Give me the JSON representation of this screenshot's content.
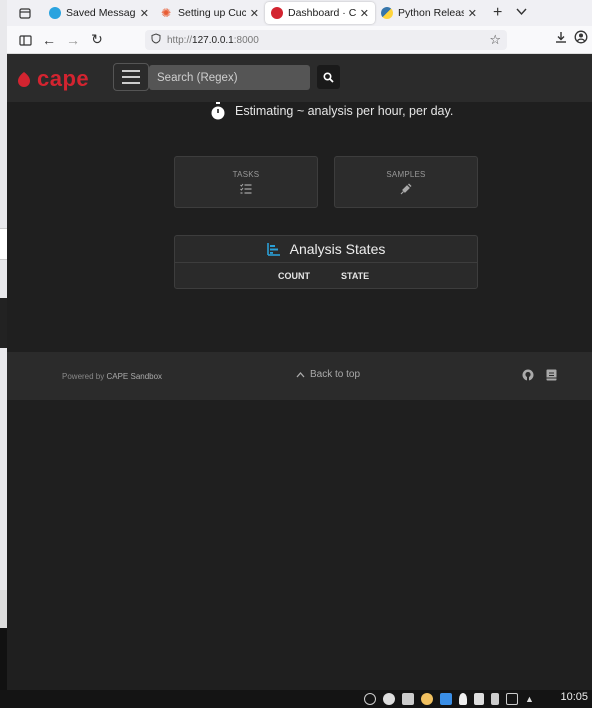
{
  "browser": {
    "tabs": [
      {
        "title": "Saved Messages",
        "fav_color": "#2aa3df"
      },
      {
        "title": "Setting up Cuckoo",
        "fav_color": "#e85c33"
      },
      {
        "title": "Dashboard · CAPE",
        "fav_color": "#d32430"
      },
      {
        "title": "Python Releases f",
        "fav_color": "#3776ab"
      }
    ],
    "url_prefix": "http://",
    "url_host": "127.0.0.1",
    "url_port": ":8000"
  },
  "cape": {
    "logo_text": "cape",
    "search_placeholder": "Search (Regex)",
    "estimate_text": "Estimating ~ analysis per hour, per day.",
    "cards": {
      "tasks_label": "TASKS",
      "samples_label": "SAMPLES"
    },
    "states": {
      "title": "Analysis States",
      "col_count": "COUNT",
      "col_state": "STATE"
    }
  },
  "footer": {
    "powered_prefix": "Powered by ",
    "powered_link": "CAPE Sandbox",
    "back_to_top": "Back to top"
  },
  "taskbar": {
    "time": "10:05"
  },
  "colors": {
    "accent": "#d32430",
    "chart_icon": "#2a9fd6",
    "page_bg": "#1f1f1f",
    "header_bg": "#2b2b2b"
  }
}
